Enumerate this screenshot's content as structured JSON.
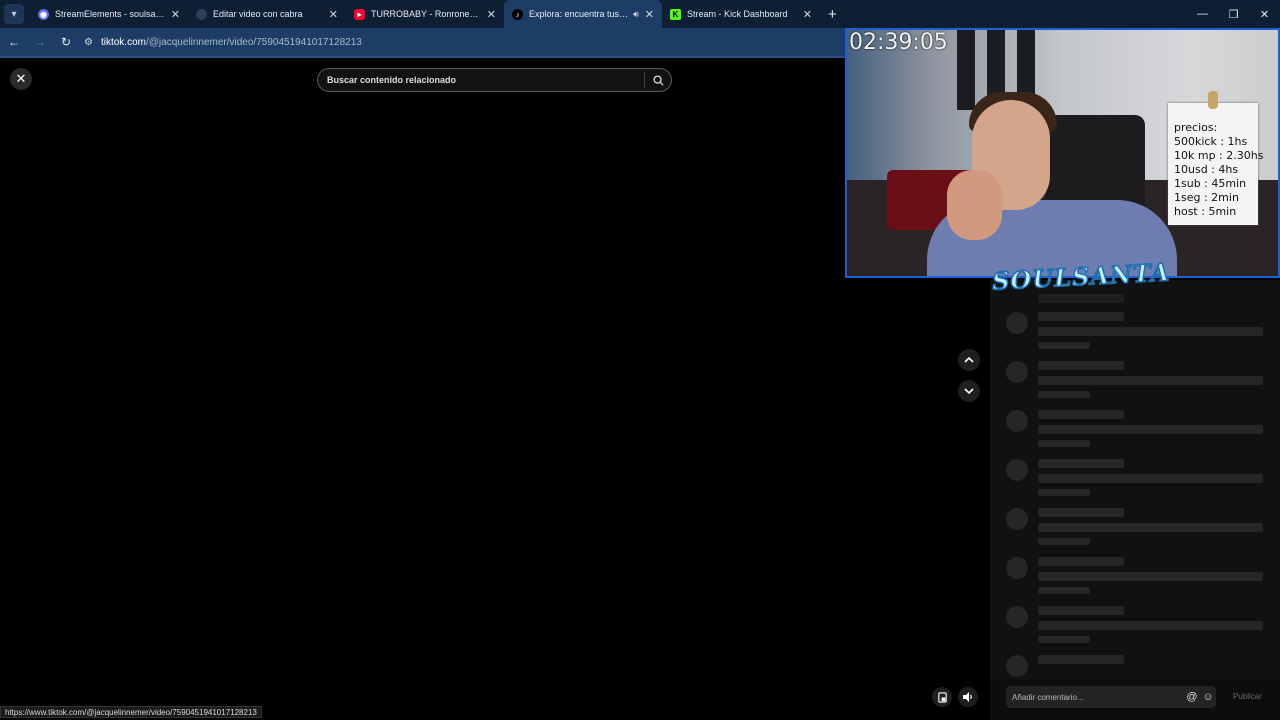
{
  "browser": {
    "tabs": [
      {
        "label": "StreamElements - soulsanta",
        "icon": "streamelements-icon",
        "color": "#5b6cf0",
        "active": false
      },
      {
        "label": "Editar video con cabra",
        "icon": "cabra-icon",
        "color": "#2b3f5a",
        "active": false
      },
      {
        "label": "TURROBABY - Ronronea (prod",
        "icon": "youtube-icon",
        "color": "#ff0033",
        "active": false
      },
      {
        "label": "Explora: encuentra tus vide",
        "icon": "tiktok-icon",
        "color": "#000000",
        "active": true
      },
      {
        "label": "Stream - Kick Dashboard",
        "icon": "kick-icon",
        "color": "#53fc18",
        "active": false
      }
    ],
    "url_host": "tiktok.com",
    "url_path": "/@jacquelinnemer/video/7590451941017128213",
    "status_url": "https://www.tiktok.com/@jacquelinnemer/video/7590451941017128213"
  },
  "tiktok": {
    "search_placeholder": "Buscar contenido relacionado",
    "comment_placeholder": "Añadir comentario...",
    "publish_label": "Publicar"
  },
  "stream_overlay": {
    "timer": "02:39:05",
    "prices": [
      "precios:",
      "500kick : 1hs",
      "10k mp : 2.30hs",
      "10usd : 4hs",
      "1sub : 45min",
      "1seg : 2min",
      "host : 5min"
    ],
    "logo_text": "SOULSANTA"
  },
  "colors": {
    "tabstrip": "#0f1f33",
    "active_tab": "#1e3d66",
    "cam_border": "#1d5fd6"
  }
}
